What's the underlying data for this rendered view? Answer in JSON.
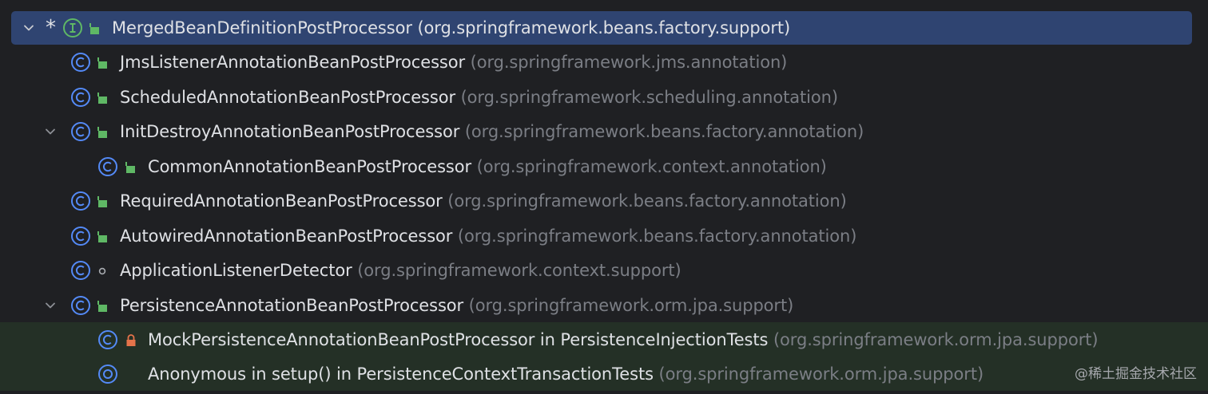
{
  "colors": {
    "background": "#1f2023",
    "selected_row": "#2f4471",
    "green_row": "#243026",
    "class_icon": "#548af7",
    "interface_icon": "#5fb865",
    "public_icon": "#5fb865",
    "private_icon": "#e5734a",
    "text": "#dfe1e5",
    "package_text": "#7b7e85"
  },
  "tree": {
    "rows": [
      {
        "expanded": true,
        "marker": "*",
        "kind_icon": "interface-icon",
        "visibility_icon": "public-icon",
        "name": "MergedBeanDefinitionPostProcessor",
        "package": "(org.springframework.beans.factory.support)",
        "selected": true
      },
      {
        "kind_icon": "class-icon",
        "visibility_icon": "public-icon",
        "name": "JmsListenerAnnotationBeanPostProcessor",
        "package": "(org.springframework.jms.annotation)"
      },
      {
        "kind_icon": "class-icon",
        "visibility_icon": "public-icon",
        "name": "ScheduledAnnotationBeanPostProcessor",
        "package": "(org.springframework.scheduling.annotation)"
      },
      {
        "expanded": true,
        "kind_icon": "class-icon",
        "visibility_icon": "public-icon",
        "name": "InitDestroyAnnotationBeanPostProcessor",
        "package": "(org.springframework.beans.factory.annotation)"
      },
      {
        "kind_icon": "class-icon",
        "visibility_icon": "public-icon",
        "name": "CommonAnnotationBeanPostProcessor",
        "package": "(org.springframework.context.annotation)"
      },
      {
        "kind_icon": "class-icon",
        "visibility_icon": "public-icon",
        "name": "RequiredAnnotationBeanPostProcessor",
        "package": "(org.springframework.beans.factory.annotation)"
      },
      {
        "kind_icon": "class-icon",
        "visibility_icon": "public-icon",
        "name": "AutowiredAnnotationBeanPostProcessor",
        "package": "(org.springframework.beans.factory.annotation)"
      },
      {
        "kind_icon": "class-icon",
        "visibility_icon": "package-private-icon",
        "name": "ApplicationListenerDetector",
        "package": "(org.springframework.context.support)"
      },
      {
        "expanded": true,
        "kind_icon": "class-icon",
        "visibility_icon": "public-icon",
        "name": "PersistenceAnnotationBeanPostProcessor",
        "package": "(org.springframework.orm.jpa.support)"
      },
      {
        "kind_icon": "class-icon",
        "visibility_icon": "private-lock-icon",
        "name": "MockPersistenceAnnotationBeanPostProcessor in PersistenceInjectionTests",
        "package": "(org.springframework.orm.jpa.support)",
        "test_scope": true
      },
      {
        "kind_icon": "anonymous-class-icon",
        "name": "Anonymous in setup() in PersistenceContextTransactionTests",
        "package": "(org.springframework.orm.jpa.support)",
        "test_scope": true
      }
    ]
  },
  "watermark": "@稀土掘金技术社区"
}
